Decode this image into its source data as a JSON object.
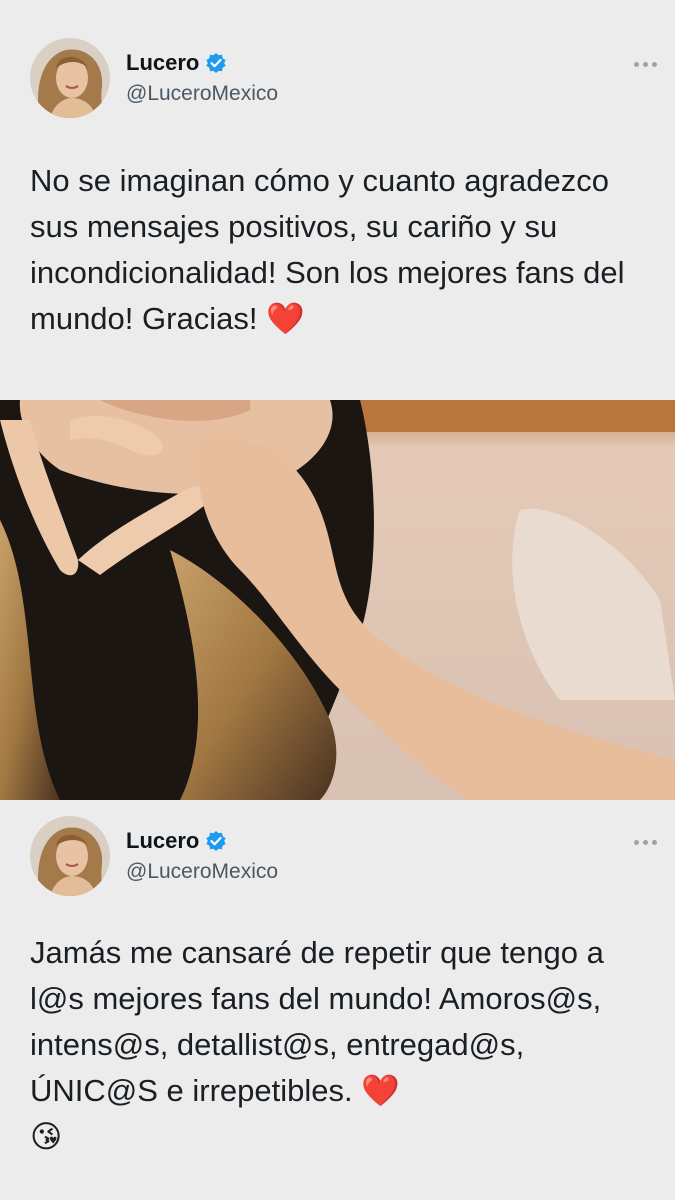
{
  "tweets": [
    {
      "display_name": "Lucero",
      "handle": "@LuceroMexico",
      "text": "No se imaginan cómo y cuanto agradezco sus mensajes positivos, su cariño y su incondicionalidad! Son los mejores fans del mundo! Gracias!",
      "emoji_end": "❤️"
    },
    {
      "display_name": "Lucero",
      "handle": "@LuceroMexico",
      "text": "Jamás me cansaré de repetir que tengo a l@s mejores fans del mundo! Amoros@s, intens@s, detallist@s, entregad@s, ÚNIC@S e irrepetibles.",
      "emoji_end": "❤️",
      "emoji_extra": "😘"
    }
  ],
  "icons": {
    "verified": "verified-badge-icon",
    "more": "more-options-icon"
  },
  "colors": {
    "background": "#ececec",
    "verified_blue": "#1d9bf0",
    "heart_red": "#e0243b"
  }
}
